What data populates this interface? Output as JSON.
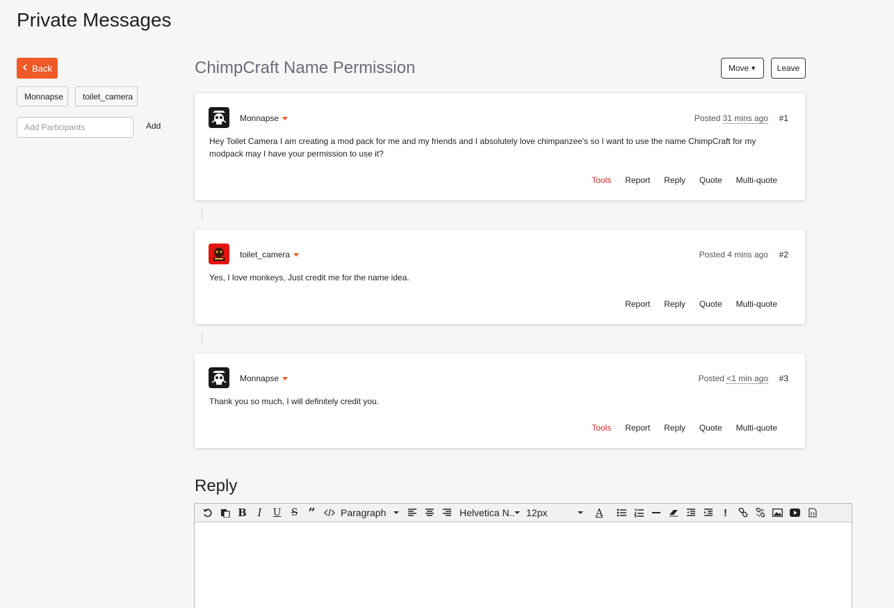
{
  "page": {
    "title": "Private Messages"
  },
  "sidebar": {
    "back_label": "Back",
    "participants": [
      "Monnapse",
      "toilet_camera"
    ],
    "add_placeholder": "Add Participants",
    "add_label": "Add"
  },
  "thread": {
    "title": "ChimpCraft Name Permission",
    "move_label": "Move",
    "leave_label": "Leave"
  },
  "posts": [
    {
      "author": "Monnapse",
      "posted_prefix": "Posted",
      "posted_ago": "31 mins ago",
      "number": "#1",
      "body": "Hey Toilet Camera I am creating a mod pack for me and my friends and I absolutely love chimpanzee's so I want to use the name ChimpCraft for my modpack may I have your permission to use it?",
      "actions": [
        "Tools",
        "Report",
        "Reply",
        "Quote",
        "Multi-quote"
      ]
    },
    {
      "author": "toilet_camera",
      "posted_prefix": "Posted",
      "posted_ago": "4 mins ago",
      "number": "#2",
      "body": "Yes, I love monkeys, Just credit me for the name idea.",
      "actions": [
        "Report",
        "Reply",
        "Quote",
        "Multi-quote"
      ]
    },
    {
      "author": "Monnapse",
      "posted_prefix": "Posted",
      "posted_ago": "<1 min ago",
      "number": "#3",
      "body": "Thank you so much, I will definitely credit you.",
      "actions": [
        "Tools",
        "Report",
        "Reply",
        "Quote",
        "Multi-quote"
      ]
    }
  ],
  "reply": {
    "heading": "Reply",
    "toolbar": {
      "paragraph": "Paragraph",
      "font": "Helvetica N..",
      "size": "12px"
    }
  },
  "colors": {
    "accent": "#f05a28",
    "tools": "#d0261d",
    "title_gray": "#6b6b78"
  }
}
